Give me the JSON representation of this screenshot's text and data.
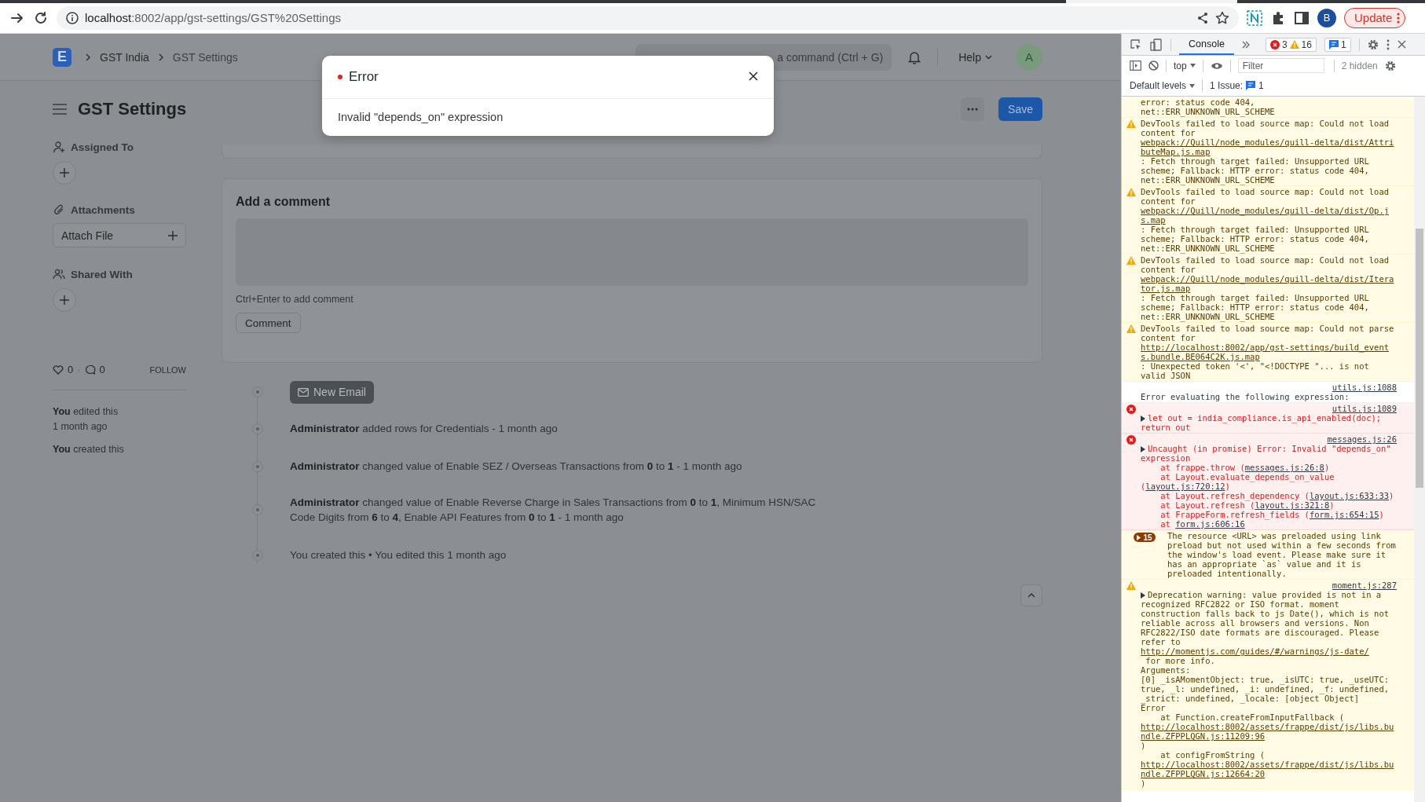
{
  "browser": {
    "host": "localhost",
    "path": ":8002/app/gst-settings/GST%20Settings",
    "profile": "B",
    "update": "Update"
  },
  "navbar": {
    "logo": "E",
    "breadcrumbs": [
      "GST India",
      "GST Settings"
    ],
    "search": {
      "placeholder": "a command (Ctrl + G)"
    },
    "help": "Help",
    "avatar": "A"
  },
  "page": {
    "title": "GST Settings",
    "save": "Save"
  },
  "sidebar": {
    "sections": [
      {
        "kind": "assign",
        "label": "Assigned To"
      },
      {
        "kind": "attach",
        "label": "Attachments",
        "button": "Attach File"
      },
      {
        "kind": "share",
        "label": "Shared With"
      }
    ],
    "likes": "0",
    "separator": "·",
    "comments": "0",
    "follow": "FOLLOW",
    "activity": [
      "**You** edited this 1 month ago",
      "**You** created this"
    ]
  },
  "comment_box": {
    "title": "Add a comment",
    "hint": "Ctrl+Enter to add comment",
    "button": "Comment"
  },
  "timeline": {
    "new_email": "New Email",
    "items": [
      "**Administrator** added rows for Credentials - 1 month ago",
      "**Administrator** changed value of Enable SEZ / Overseas Transactions from **0** to **1** - 1 month ago",
      "**Administrator** changed value of Enable Reverse Charge in Sales Transactions from **0** to **1**, Minimum HSN/SAC Code Digits from **6** to **4**, Enable API Features from **0** to **1** - 1 month ago",
      "You created this • You edited this 1 month ago"
    ]
  },
  "modal": {
    "title": "Error",
    "message": "Invalid \"depends_on\" expression"
  },
  "devtools": {
    "tabs": [
      {
        "label": "Console",
        "selected": true
      }
    ],
    "errors": "3",
    "warnings": "16",
    "info": "1",
    "context": "top",
    "filter": {
      "placeholder": "Filter"
    },
    "hidden": "2 hidden",
    "levels": "Default levels",
    "issues": "1 Issue:",
    "issue_count": "1",
    "messages": [
      {
        "kind": "warning",
        "continued": true,
        "parts": [
          {
            "text": "error: status code 404,\nnet::ERR_UNKNOWN_URL_SCHEME"
          }
        ]
      },
      {
        "kind": "warning",
        "parts": [
          {
            "text": "DevTools failed to load source map: Could not load content for "
          },
          {
            "text": "webpack://Quill/node_modules/quill-delta/dist/AttributeMap.js.map",
            "link": true
          },
          {
            "text": ": Fetch through target failed: Unsupported URL scheme; Fallback: HTTP error: status code 404, net::ERR_UNKNOWN_URL_SCHEME"
          }
        ]
      },
      {
        "kind": "warning",
        "parts": [
          {
            "text": "DevTools failed to load source map: Could not load content for "
          },
          {
            "text": "webpack://Quill/node_modules/quill-delta/dist/Op.js.map",
            "link": true
          },
          {
            "text": ": Fetch through target failed: Unsupported URL scheme; Fallback: HTTP error: status code 404, net::ERR_UNKNOWN_URL_SCHEME"
          }
        ]
      },
      {
        "kind": "warning",
        "parts": [
          {
            "text": "DevTools failed to load source map: Could not load content for "
          },
          {
            "text": "webpack://Quill/node_modules/quill-delta/dist/Iterator.js.map",
            "link": true
          },
          {
            "text": ": Fetch through target failed: Unsupported URL scheme; Fallback: HTTP error: status code 404, net::ERR_UNKNOWN_URL_SCHEME"
          }
        ]
      },
      {
        "kind": "warning",
        "parts": [
          {
            "text": "DevTools failed to load source map: Could not parse content for "
          },
          {
            "text": "http://localhost:8002/app/gst-settings/build_events.bundle.BE064C2K.js.map",
            "link": true
          },
          {
            "text": ": Unexpected token '<', \"<!DOCTYPE \"... is not valid JSON"
          }
        ]
      },
      {
        "kind": "info",
        "source": "utils.js:1088",
        "parts": [
          {
            "text": "Error evaluating the following expression:"
          }
        ]
      },
      {
        "kind": "error",
        "expandable": true,
        "source": "utils.js:1089",
        "parts": [
          {
            "text": "let out = india_compliance.is_api_enabled(doc); return out"
          }
        ]
      },
      {
        "kind": "error",
        "expandable": true,
        "source": "messages.js:26",
        "parts": [
          {
            "text": "Uncaught (in promise) Error: Invalid \"depends_on\" expression\n    at frappe.throw ("
          },
          {
            "text": "messages.js:26:8",
            "link": true
          },
          {
            "text": ")\n    at Layout.evaluate_depends_on_value ("
          },
          {
            "text": "layout.js:720:12",
            "link": true
          },
          {
            "text": ")\n    at Layout.refresh_dependency ("
          },
          {
            "text": "layout.js:633:33",
            "link": true
          },
          {
            "text": ")\n    at Layout.refresh ("
          },
          {
            "text": "layout.js:321:8",
            "link": true
          },
          {
            "text": ")\n    at FrappeForm.refresh_fields ("
          },
          {
            "text": "form.js:654:15",
            "link": true
          },
          {
            "text": ")\n    at "
          },
          {
            "text": "form.js:606:16",
            "link": true
          }
        ]
      },
      {
        "kind": "warning",
        "repeat": "15",
        "parts": [
          {
            "text": "The resource <URL> was preloaded using link preload but not used within a few seconds from the window's load event. Please make sure it has an appropriate `as` value and it is preloaded intentionally."
          }
        ]
      },
      {
        "kind": "warning",
        "expandable": true,
        "source": "moment.js:287",
        "parts": [
          {
            "text": "Deprecation warning: value provided is not in a recognized RFC2822 or ISO format. moment construction falls back to js Date(), which is not reliable across all browsers and versions. Non RFC2822/ISO date formats are discouraged. Please refer to "
          },
          {
            "text": "http://momentjs.com/guides/#/warnings/js-date/",
            "link": true
          },
          {
            "text": " for more info.\nArguments:\n[0] _isAMomentObject: true, _isUTC: true, _useUTC: true, _l: undefined, _i: undefined, _f: undefined, _strict: undefined, _locale: [object Object]\nError\n    at Function.createFromInputFallback ("
          },
          {
            "text": "http://localhost:8002/assets/frappe/dist/js/libs.bundle.ZFPPLQGN.js:11209:96",
            "link": true
          },
          {
            "text": ")\n    at configFromString ("
          },
          {
            "text": "http://localhost:8002/assets/frappe/dist/js/libs.bundle.ZFPPLQGN.js:12664:20",
            "link": true
          },
          {
            "text": ")"
          }
        ]
      }
    ]
  }
}
